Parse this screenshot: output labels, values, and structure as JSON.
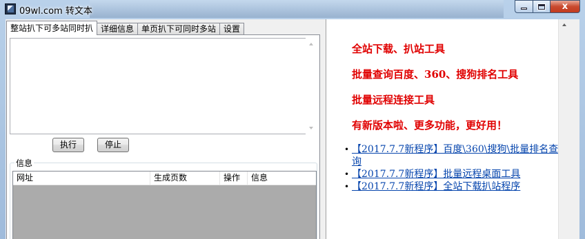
{
  "window": {
    "title": "09wl.com 转文本",
    "controls": {
      "minimize_icon": "minimize-icon",
      "maximize_icon": "maximize-icon",
      "close_glyph": "x"
    }
  },
  "tabs": [
    {
      "label": "整站扒下可多站同时扒",
      "active": true
    },
    {
      "label": "详细信息",
      "active": false
    },
    {
      "label": "单页扒下可同时多站",
      "active": false
    },
    {
      "label": "设置",
      "active": false
    }
  ],
  "panel": {
    "input_value": "",
    "buttons": {
      "execute": "执行",
      "stop": "停止"
    },
    "group_label": "信息",
    "table": {
      "columns": [
        "网址",
        "生成页数",
        "操作",
        "信息"
      ],
      "rows": []
    }
  },
  "ad": {
    "promos": [
      "全站下载、扒站工具",
      "批量查询百度、360、搜狗排名工具",
      "批量远程连接工具",
      "有新版本啦、更多功能，更好用！"
    ],
    "links": [
      "【2017.7.7新程序】百度\\360\\搜狗\\批量排名查询",
      "【2017.7.7新程序】批量远程桌面工具",
      "【2017.7.7新程序】全站下载扒站程序"
    ],
    "bullet": "•"
  },
  "colors": {
    "promo_red": "#e00000",
    "link_blue": "#0645ad",
    "titlebar": "#b9d1ea"
  }
}
